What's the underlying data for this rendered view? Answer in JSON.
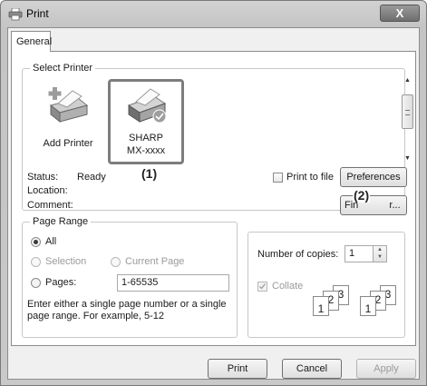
{
  "window": {
    "title": "Print",
    "close_glyph": "X"
  },
  "tabs": [
    {
      "label": "General"
    }
  ],
  "select_printer": {
    "legend": "Select Printer",
    "items": [
      {
        "label": "Add Printer",
        "icon": "add-printer-icon"
      },
      {
        "label_line1": "SHARP",
        "label_line2": "MX-xxxx",
        "icon": "printer-icon"
      }
    ],
    "status_label": "Status:",
    "status_value": "Ready",
    "location_label": "Location:",
    "comment_label": "Comment:",
    "print_to_file_label": "Print to file",
    "preferences_label": "Preferences",
    "find_printer_label_start": "Fin",
    "find_printer_label_end": "r..."
  },
  "callouts": {
    "one": "(1)",
    "two": "(2)"
  },
  "page_range": {
    "legend": "Page Range",
    "all_label": "All",
    "selection_label": "Selection",
    "current_page_label": "Current Page",
    "pages_label": "Pages:",
    "pages_value": "1-65535",
    "hint_line1": "Enter either a single page number or a single",
    "hint_line2": "page range.  For example, 5-12"
  },
  "copies": {
    "label": "Number of copies:",
    "value": "1",
    "collate_label": "Collate",
    "collate_checked": true,
    "stack_labels": [
      "1",
      "2",
      "3"
    ]
  },
  "footer": {
    "print_label": "Print",
    "cancel_label": "Cancel",
    "apply_label": "Apply"
  },
  "colors": {
    "highlight_frame": "#7d7d7d",
    "window_bg": "#f0f0f0"
  }
}
